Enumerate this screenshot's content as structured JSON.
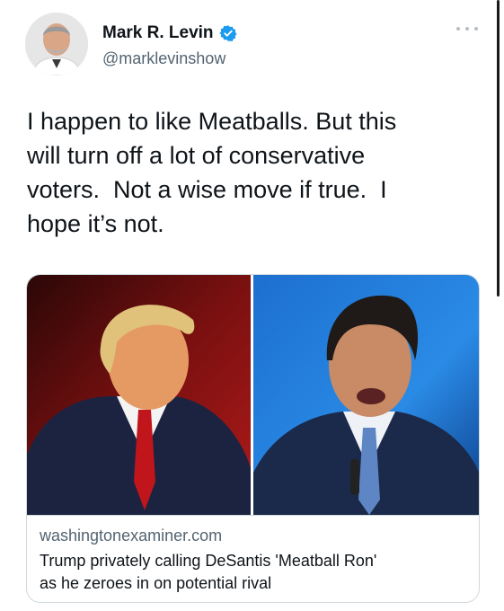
{
  "author": {
    "name": "Mark R. Levin",
    "handle": "@marklevinshow",
    "verified": true,
    "avatar_icon": "person-avatar"
  },
  "tweet": {
    "text": "I happen to like Meatballs. But this\nwill turn off a lot of conservative\nvoters.  Not a wise move if true.  I\nhope it’s not."
  },
  "link_card": {
    "domain": "washingtonexaminer.com",
    "title": "Trump privately calling DeSantis 'Meatball Ron'\nas he zeroes in on potential rival",
    "images": [
      "photo-portrait-red-background",
      "photo-portrait-blue-background"
    ]
  },
  "colors": {
    "verified_blue": "#1d9bf0",
    "secondary_text": "#536471",
    "border": "#cfd9de"
  }
}
